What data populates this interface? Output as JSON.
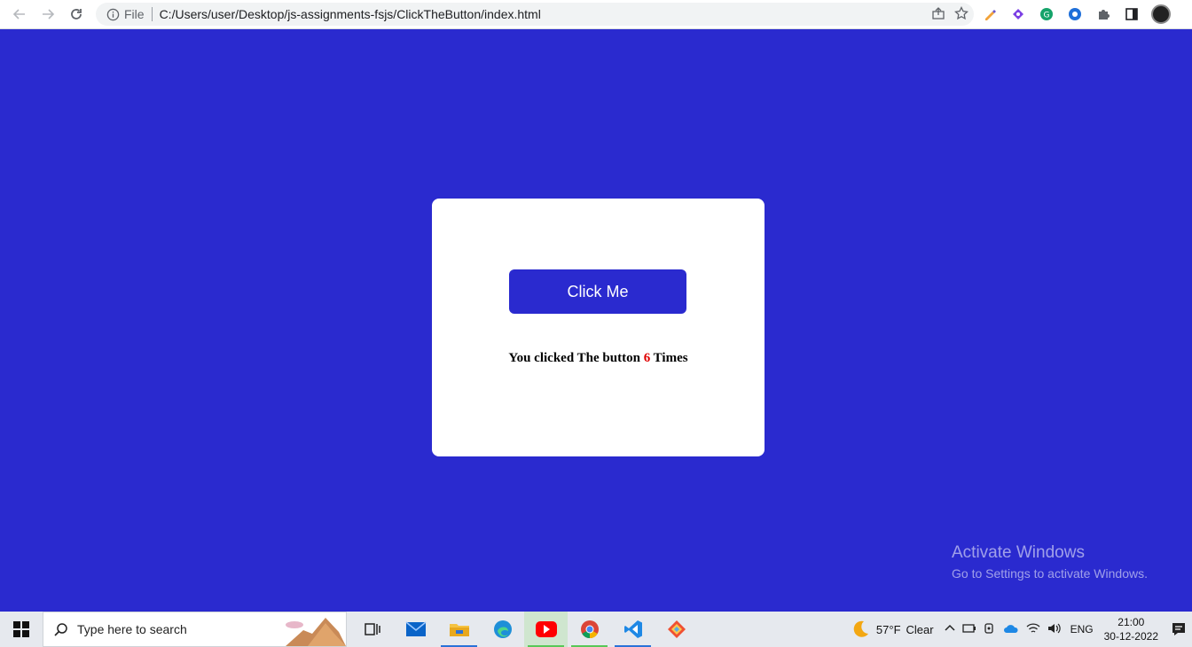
{
  "browser": {
    "scheme_label": "File",
    "url": "C:/Users/user/Desktop/js-assignments-fsjs/ClickTheButton/index.html",
    "icons": [
      "back-arrow-icon",
      "forward-arrow-icon",
      "reload-icon",
      "info-icon",
      "share-icon",
      "star-icon",
      "pen-extension-icon",
      "purple-extension-icon",
      "grammarly-extension-icon",
      "blue-extension-icon",
      "puzzle-icon",
      "sidepanel-icon",
      "profile-avatar"
    ]
  },
  "page": {
    "background": "#2a2acf",
    "button_label": "Click Me",
    "result_prefix": "You clicked The button",
    "click_count": "6",
    "result_suffix": "Times",
    "count_color": "#e00000"
  },
  "watermark": {
    "title": "Activate Windows",
    "subtitle": "Go to Settings to activate Windows."
  },
  "taskbar": {
    "search_placeholder": "Type here to search",
    "apps": [
      "task-view-icon",
      "mail-icon",
      "file-explorer-icon",
      "edge-icon",
      "youtube-icon",
      "chrome-icon",
      "vscode-icon",
      "git-icon"
    ],
    "weather_temp": "57°F",
    "weather_desc": "Clear",
    "language": "ENG",
    "time": "21:00",
    "date": "30-12-2022"
  }
}
